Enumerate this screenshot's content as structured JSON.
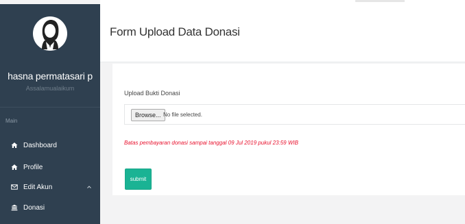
{
  "sidebar": {
    "username": "hasna permatasari p",
    "greeting": "Assalamualaikum",
    "nav_header": "Main",
    "items": [
      {
        "label": "Dashboard",
        "icon": "home-icon"
      },
      {
        "label": "Profile",
        "icon": "home-icon"
      },
      {
        "label": "Edit Akun",
        "icon": "envelope-icon",
        "has_submenu": true
      },
      {
        "label": "Donasi",
        "icon": "bank-icon"
      }
    ]
  },
  "header": {
    "title": "Form Upload Data Donasi"
  },
  "form": {
    "label": "Upload Bukti Donasi",
    "browse_label": "Browse...",
    "file_status": "No file selected.",
    "deadline_note": "Batas pembayaran donasi sampai tanggal 09 Jul 2019 pukul 23:59 WIB",
    "submit_label": "submit"
  },
  "colors": {
    "sidebar_bg": "#2f4050",
    "accent": "#1ab394",
    "warning_text": "#e8112d"
  }
}
